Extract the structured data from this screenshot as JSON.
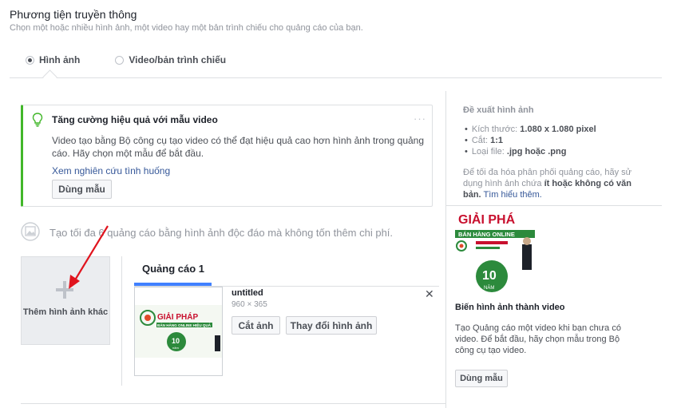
{
  "section": {
    "title": "Phương tiện truyền thông",
    "subtitle": "Chọn một hoặc nhiều hình ảnh, một video hay một bản trình chiếu cho quảng cáo của bạn."
  },
  "media_type": {
    "options": [
      "Hình ảnh",
      "Video/bản trình chiếu"
    ],
    "selected": "Hình ảnh"
  },
  "tip": {
    "title": "Tăng cường hiệu quả với mẫu video",
    "more": "···",
    "body": "Video tạo bằng Bộ công cụ tạo video có thể đạt hiệu quả cao hơn hình ảnh trong quảng cáo. Hãy chọn một mẫu để bắt đầu.",
    "link": "Xem nghiên cứu tình huống",
    "button": "Dùng mẫu"
  },
  "info_text": "Tạo tối đa 6 quảng cáo bằng hình ảnh độc đáo mà không tốn thêm chi phí.",
  "add_image": {
    "label": "Thêm hình ảnh khác"
  },
  "ad": {
    "tab_label": "Quảng cáo 1",
    "file_name": "untitled",
    "dimensions": "960 × 365",
    "crop_button": "Cắt ảnh",
    "change_button": "Thay đổi hình ảnh",
    "close": "✕",
    "thumb_text": {
      "line1": "GIẢI PHÁP",
      "line2": "BÁN HÀNG ONLINE HIỆU QUẢ",
      "badge_num": "10",
      "badge_text": "năm"
    }
  },
  "recommend": {
    "title": "Đề xuất hình ảnh",
    "items": [
      {
        "label": "Kích thước: ",
        "value": "1.080 x 1.080 pixel"
      },
      {
        "label": "Cắt: ",
        "value": "1:1"
      },
      {
        "label": "Loại file: ",
        "value": ".jpg hoặc .png"
      }
    ],
    "note_pre": "Để tối đa hóa phân phối quảng cáo, hãy sử dụng hình ảnh chứa ",
    "note_bold": "ít hoặc không có văn bản.",
    "note_link": " Tìm hiểu thêm."
  },
  "promo": {
    "img_text": {
      "line1": "GIẢI PHÁ",
      "line2": "BÁN HÀNG ONLINE",
      "badge_num": "10",
      "badge_text": "NĂM"
    },
    "title": "Biến hình ảnh thành video",
    "body": "Tạo Quảng cáo một video khi bạn chưa có video. Để bắt đầu, hãy chọn mẫu trong Bộ công cụ tạo video.",
    "button": "Dùng mẫu"
  },
  "colors": {
    "accent": "#42b72a",
    "link": "#365899",
    "tab_active": "#4080ff",
    "arrow": "#e0141e"
  }
}
